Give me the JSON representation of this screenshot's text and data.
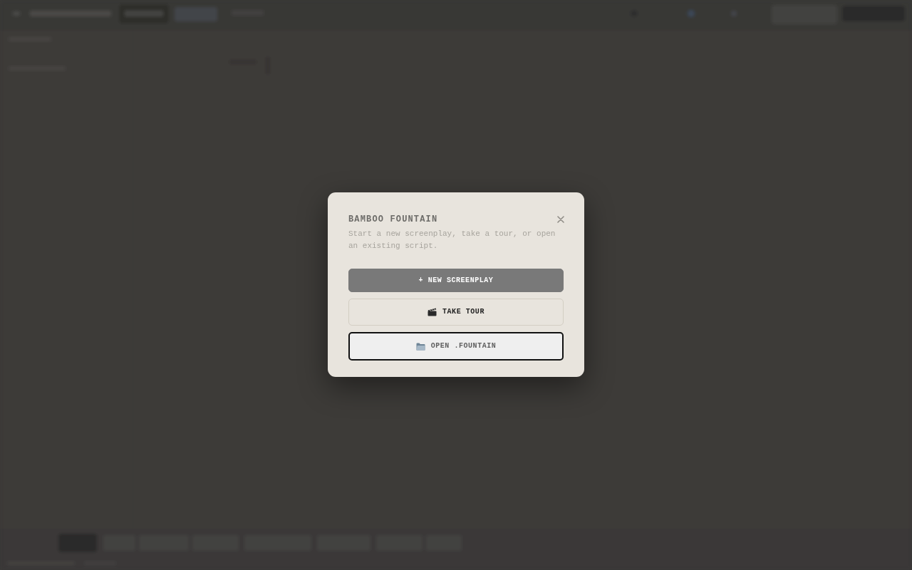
{
  "dialog": {
    "title": "BAMBOO FOUNTAIN",
    "description": "Start a new screenplay, take a tour, or open an existing script.",
    "buttons": [
      {
        "kind": "primary",
        "label": "+ NEW SCREENPLAY",
        "focused": false
      },
      {
        "kind": "tour",
        "label": "TAKE TOUR",
        "focused": false
      },
      {
        "kind": "open",
        "label": "OPEN .FOUNTAIN",
        "focused": true
      }
    ]
  }
}
